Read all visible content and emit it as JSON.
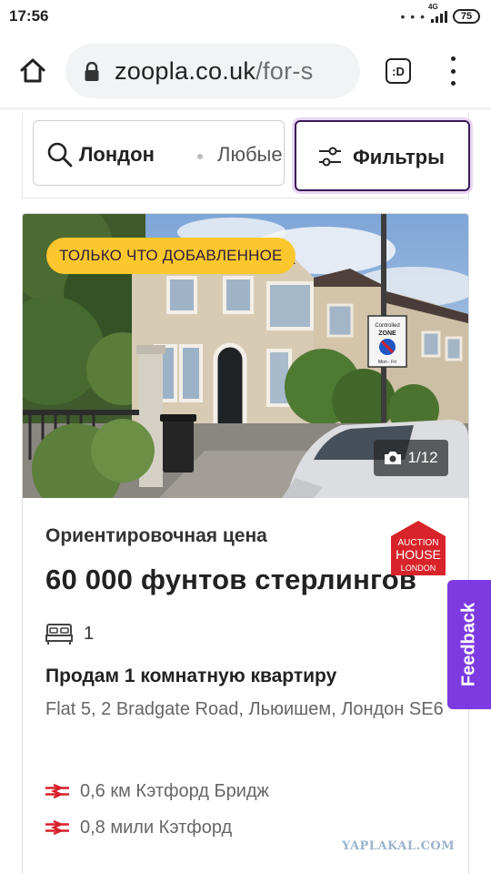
{
  "status_bar": {
    "time": "17:56",
    "dots": "• • •",
    "network": "4G",
    "battery": "75"
  },
  "browser": {
    "url_domain": "zoopla.co.uk",
    "url_path": "/for-s",
    "tab_switcher_label": ":D"
  },
  "search": {
    "location": "Лондон",
    "property_type": "Любые…",
    "filters_label": "Фильтры"
  },
  "listing": {
    "badge": "ТОЛЬКО ЧТО ДОБАВЛЕННОЕ",
    "photo_counter": "1/12",
    "price_label": "Ориентировочная цена",
    "price": "60 000 фунтов стерлингов",
    "agent_logo": {
      "line1": "AUCTION",
      "line2": "HOUSE",
      "line3": "LONDON"
    },
    "bedrooms": "1",
    "title": "Продам 1 комнатную квартиру",
    "address": "Flat 5, 2 Bradgate Road, Льюишем, Лондон SE6",
    "photo_sign": {
      "line1": "Controlled",
      "line2": "ZONE",
      "line3": "Mon - Fri"
    },
    "stations": [
      {
        "distance": "0,6 км Кэтфорд Бридж"
      },
      {
        "distance": "0,8 мили Кэтфорд"
      }
    ]
  },
  "feedback_label": "Feedback",
  "watermark": "YAPLAKAL.COM",
  "colors": {
    "badge_yellow": "#fcc72c",
    "brand_purple": "#3b1a57",
    "feedback_purple": "#7c3ae0",
    "rail_red": "#d9202a"
  }
}
